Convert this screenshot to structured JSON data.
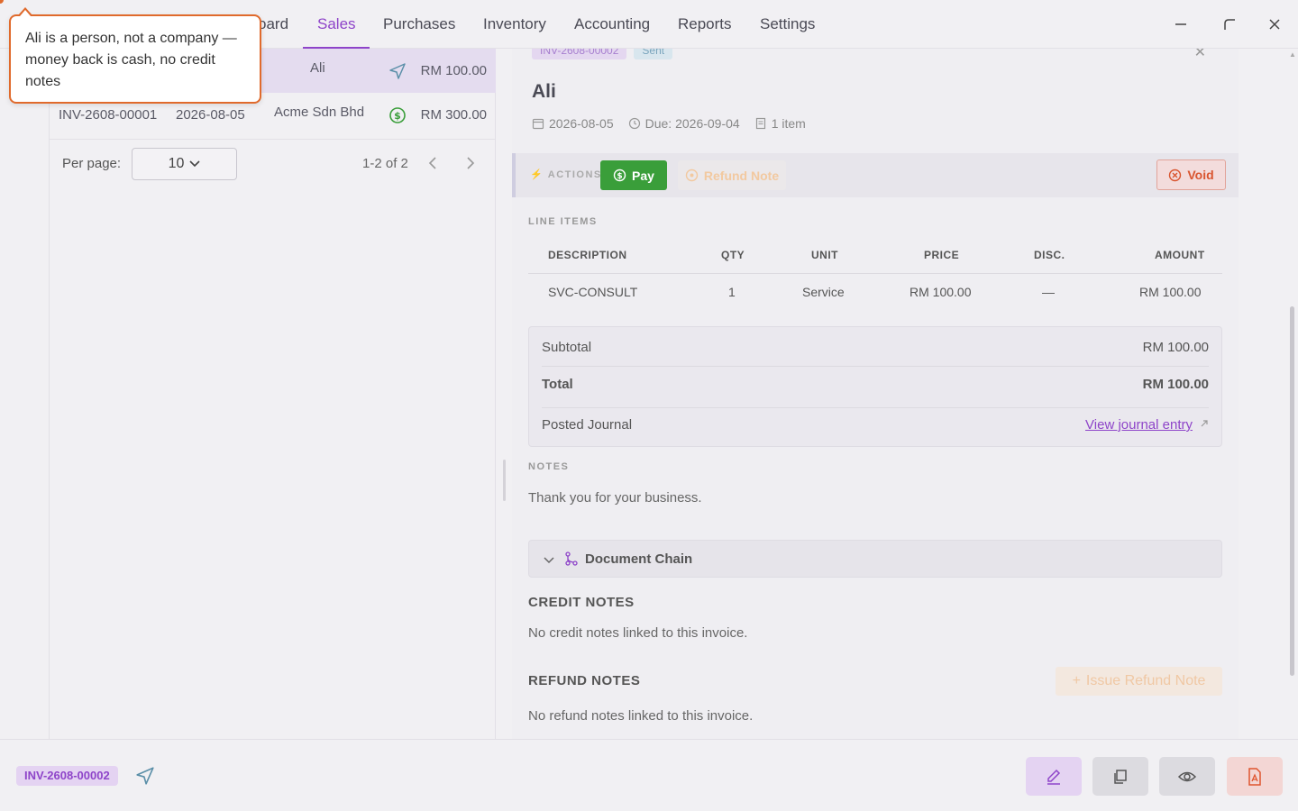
{
  "nav": {
    "items": [
      "oard",
      "Sales",
      "Purchases",
      "Inventory",
      "Accounting",
      "Reports",
      "Settings"
    ],
    "active": "Sales"
  },
  "list": {
    "rows": [
      {
        "number": "",
        "date": "",
        "customer": "Ali",
        "status_icon": "send-icon",
        "amount": "RM 100.00"
      },
      {
        "number": "INV-2608-00001",
        "date": "2026-08-05",
        "customer": "Acme Sdn Bhd",
        "status_icon": "dollar-circle-icon",
        "amount": "RM 300.00"
      }
    ],
    "per_page_label": "Per page:",
    "per_page_value": "10",
    "count": "1-2 of 2"
  },
  "detail": {
    "badge_number": "INV-2608-00002",
    "badge_status": "Sent",
    "title": "Ali",
    "date": "2026-08-05",
    "due": "Due: 2026-09-04",
    "items": "1 item",
    "actions_label": "ACTIONS",
    "pay_label": "Pay",
    "refund_note_label": "Refund Note",
    "void_label": "Void",
    "line_items_label": "LINE ITEMS",
    "columns": [
      "DESCRIPTION",
      "QTY",
      "UNIT",
      "PRICE",
      "DISC.",
      "AMOUNT"
    ],
    "line": {
      "description": "SVC-CONSULT",
      "qty": "1",
      "unit": "Service",
      "price": "RM 100.00",
      "disc": "—",
      "amount": "RM 100.00"
    },
    "subtotal_label": "Subtotal",
    "subtotal_value": "RM 100.00",
    "total_label": "Total",
    "total_value": "RM 100.00",
    "posted_label": "Posted Journal",
    "journal_link": "View journal entry",
    "notes_label": "NOTES",
    "notes_text": "Thank you for your business.",
    "doc_chain_label": "Document Chain",
    "credit_heading": "CREDIT NOTES",
    "credit_text": "No credit notes linked to this invoice.",
    "refund_heading": "REFUND NOTES",
    "refund_text": "No refund notes linked to this invoice.",
    "issue_refund_label": "Issue Refund Note"
  },
  "bottom": {
    "invoice_badge": "INV-2608-00002"
  },
  "tooltip": {
    "text": "Ali is a person, not a company — money back is cash, no credit notes"
  },
  "colors": {
    "accent": "#8e44c9",
    "pay": "#3a9e3a",
    "void": "#d9552f",
    "tooltip_border": "#e06a2c"
  }
}
